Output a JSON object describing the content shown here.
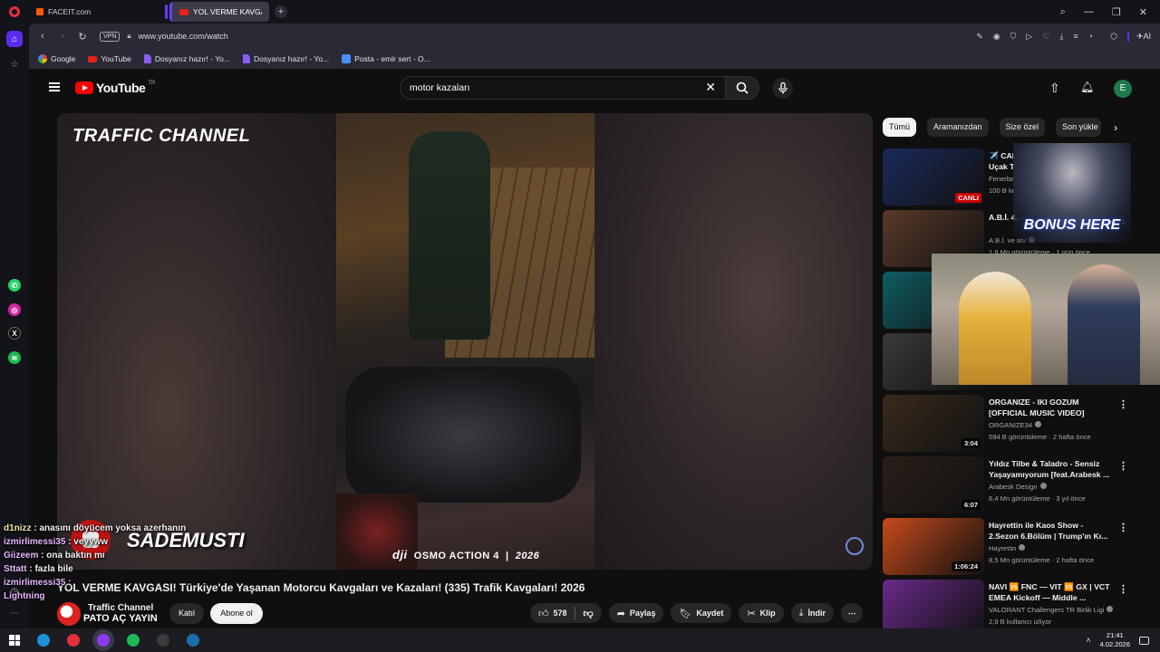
{
  "browser": {
    "tabs": [
      {
        "label": "FACEIT.com"
      },
      {
        "label": "YOL VERME KAVGASI! Tü"
      }
    ],
    "new_tab": "+",
    "url": "www.youtube.com/watch",
    "vpn": "VPN",
    "ai_label": "AI",
    "bookmarks": [
      {
        "label": "Google",
        "icon": "google-icon"
      },
      {
        "label": "YouTube",
        "icon": "youtube-icon"
      },
      {
        "label": "Dosyanız hazır! - Yo...",
        "icon": "document-icon"
      },
      {
        "label": "Dosyanız hazır! - Yo...",
        "icon": "document-icon"
      },
      {
        "label": "Posta - emir sert - O...",
        "icon": "mail-icon"
      }
    ],
    "sidebar_apps": [
      {
        "name": "whatsapp",
        "color": "#25d366"
      },
      {
        "name": "instagram",
        "color": "#d6249f"
      },
      {
        "name": "x",
        "color": "#111111"
      },
      {
        "name": "spotify",
        "color": "#1db954"
      }
    ]
  },
  "youtube": {
    "logo_word": "YouTube",
    "region": "TR",
    "search_query": "motor kazaları",
    "avatar_letter": "E",
    "player": {
      "channel_logo": "TRAFFIC CHANNEL",
      "camera_mark": "OSMO ACTION 4",
      "camera_brand": "dji",
      "year_mark": "2026"
    },
    "chips": [
      "Tümü",
      "Aramanızdan",
      "Size özel",
      "Son yükle"
    ],
    "recommendations": [
      {
        "title": "✈️ CANLI | N'Golo Kante Özel Uçak Takip ve Karşılama",
        "channel": "Fenerbahçe S...",
        "meta": "100 B kullanıcı izliyor",
        "badge": "CANLI",
        "thumb_color": "#1b2a5a"
      },
      {
        "title": "A.B.İ. 4. Bölüm",
        "channel": "A.B.İ. ve atv",
        "meta": "1,8 Mn görüntüleme · 1 gün önce",
        "badge": "",
        "thumb_color": "#5a3a2a"
      },
      {
        "title": "",
        "channel": "",
        "meta": "",
        "badge": "",
        "thumb_color": "#0f5d63"
      },
      {
        "title": "",
        "channel": "",
        "meta": "",
        "badge": "",
        "thumb_color": "#3a3a3a"
      },
      {
        "title": "ORGANIZE - IKI GOZUM [OFFICIAL MUSIC VIDEO]",
        "channel": "ORGANIZE34",
        "meta": "594 B görüntüleme · 2 hafta önce",
        "badge": "3:04",
        "thumb_color": "#3a2a1c"
      },
      {
        "title": "Yıldız Tilbe & Taladro - Sensiz Yaşayamıyorum [feat.Arabesk ...",
        "channel": "Arabesk Design",
        "meta": "6,4 Mn görüntüleme · 3 yıl önce",
        "badge": "6:07",
        "thumb_color": "#2a1e18"
      },
      {
        "title": "Hayrettin ile Kaos Show - 2.Sezon 6.Bölüm | Trump'ın Kı...",
        "channel": "Hayrettin",
        "meta": "8,5 Mn görüntüleme · 2 hafta önce",
        "badge": "1:06:24",
        "thumb_color": "#c84a1a"
      },
      {
        "title": "NAVI 🆚 FNC — VIT 🆚 GX | VCT EMEA Kickoff — Middle ...",
        "channel": "VALORANT Challengers TR Birlik Ligi",
        "meta": "2,9 B kullanıcı izliyor",
        "badge": "",
        "thumb_color": "#6a2a8a"
      }
    ],
    "video": {
      "title": "YOL VERME KAVGASI! Türkiye'de Yaşanan Motorcu Kavgaları ve Kazaları! (335) Trafik Kavgaları! 2026",
      "channel": "Traffic Channel",
      "join": "Katıl",
      "subscribe": "Abone ol",
      "likes": "578",
      "share": "Paylaş",
      "save": "Kaydet",
      "clip": "Klip",
      "download": "İndir"
    }
  },
  "overlay": {
    "bonus": "BONUS HERE",
    "streamer": "SADEMUSTI",
    "banner": "PATO AÇ YAYIN",
    "chat": [
      {
        "user": "d1nizz",
        "msg": ": anasını döyücem yoksa azerhanın"
      },
      {
        "user": "izmirlimessi35",
        "msg": ": veyyww"
      },
      {
        "user": "Giizeem",
        "msg": ": ona baktın mı"
      },
      {
        "user": "Sttatt",
        "msg": ": fazla bile"
      },
      {
        "user": "izmirlimessi35",
        "msg": ":"
      },
      {
        "user": "Lightning",
        "msg": ""
      }
    ]
  },
  "taskbar": {
    "time": "21:41",
    "date": "4.02.2026",
    "apps": [
      {
        "name": "edge",
        "color": "#1f8fd6"
      },
      {
        "name": "opera",
        "color": "#e0303c"
      },
      {
        "name": "opera-gx",
        "color": "#8a3cf0"
      },
      {
        "name": "spotify",
        "color": "#1db954"
      },
      {
        "name": "steam-like",
        "color": "#3a3a3a"
      },
      {
        "name": "steam",
        "color": "#1b6ea8"
      }
    ]
  }
}
